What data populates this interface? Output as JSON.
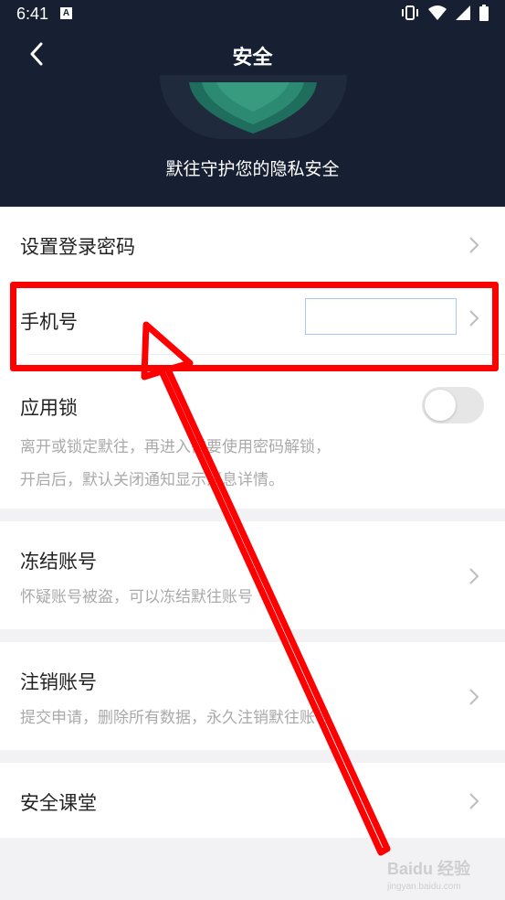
{
  "status_bar": {
    "time": "6:41",
    "notification_badge": "A"
  },
  "header": {
    "title": "安全",
    "subtitle": "默往守护您的隐私安全",
    "bg_color": "#172033",
    "shield_color": "#1f6e5d"
  },
  "items": {
    "set_password": {
      "label": "设置登录密码"
    },
    "phone": {
      "label": "手机号",
      "value": ""
    },
    "app_lock": {
      "label": "应用锁",
      "desc_line1": "离开或锁定默往，再进入需要使用密码解锁，",
      "desc_line2": "开启后，默认关闭通知显示消息详情。",
      "enabled": false
    },
    "freeze": {
      "label": "冻结账号",
      "desc": "怀疑账号被盗，可以冻结默往账号"
    },
    "cancel": {
      "label": "注销账号",
      "desc": "提交申请，删除所有数据，永久注销默往账号"
    },
    "classroom": {
      "label": "安全课堂"
    }
  },
  "annotation_color": "#ff0000",
  "watermark": {
    "text": "Baidu 经验",
    "subtext": "jingyan.baidu.com"
  }
}
